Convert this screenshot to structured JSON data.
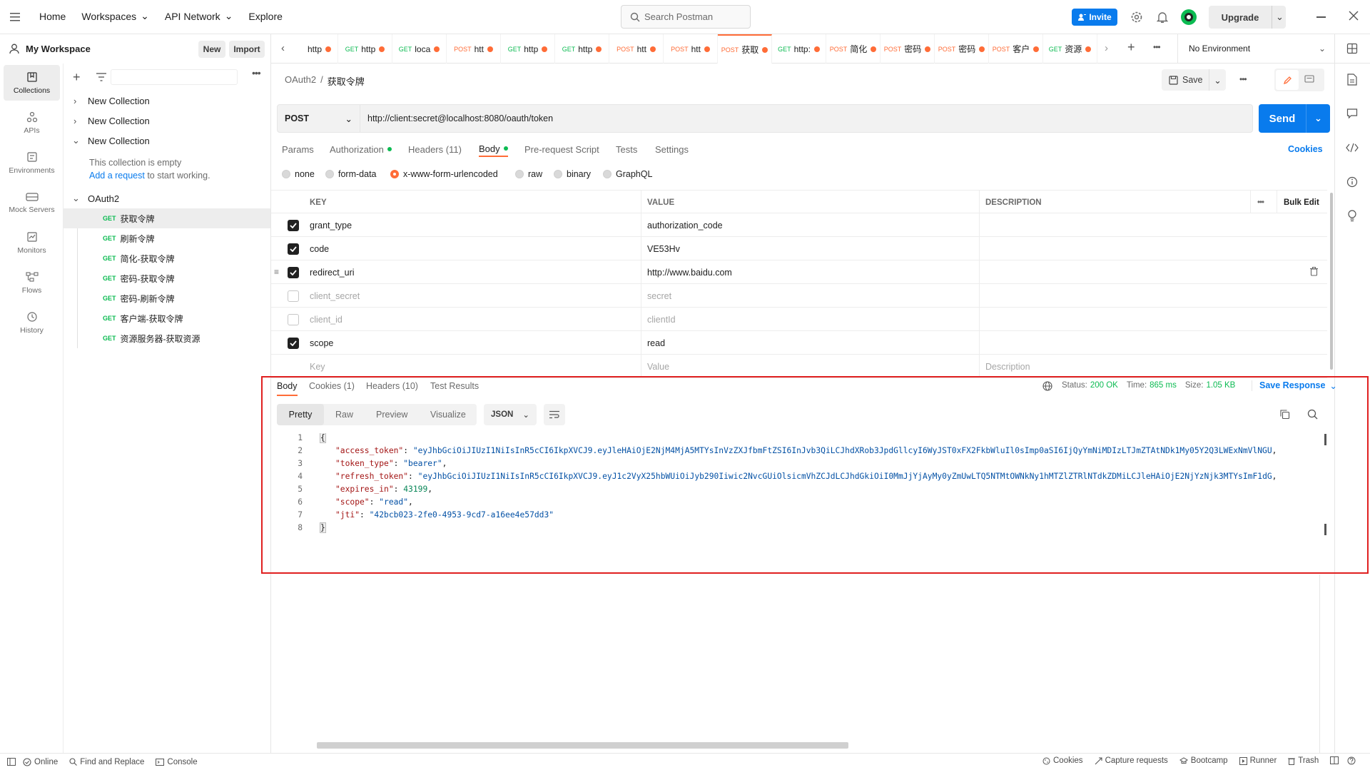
{
  "topbar": {
    "nav": [
      "Home",
      "Workspaces",
      "API Network",
      "Explore"
    ],
    "search_placeholder": "Search Postman",
    "invite_label": "Invite",
    "upgrade_label": "Upgrade"
  },
  "workspace": {
    "name": "My Workspace",
    "new_label": "New",
    "import_label": "Import"
  },
  "rail": [
    "Collections",
    "APIs",
    "Environments",
    "Mock Servers",
    "Monitors",
    "Flows",
    "History"
  ],
  "sidebar": {
    "collections": [
      "New Collection",
      "New Collection",
      "New Collection"
    ],
    "empty_text": "This collection is empty",
    "add_request_link": "Add a request",
    "add_request_rest": " to start working.",
    "oauth_folder": "OAuth2",
    "requests": [
      {
        "method": "GET",
        "name": "获取令牌"
      },
      {
        "method": "GET",
        "name": "刷新令牌"
      },
      {
        "method": "GET",
        "name": "简化-获取令牌"
      },
      {
        "method": "GET",
        "name": "密码-获取令牌"
      },
      {
        "method": "GET",
        "name": "密码-刷新令牌"
      },
      {
        "method": "GET",
        "name": "客户端-获取令牌"
      },
      {
        "method": "GET",
        "name": "资源服务器-获取资源"
      }
    ]
  },
  "tabs": [
    {
      "method": "",
      "label": "http"
    },
    {
      "method": "GET",
      "label": "http"
    },
    {
      "method": "GET",
      "label": "loca"
    },
    {
      "method": "POST",
      "label": "htt"
    },
    {
      "method": "GET",
      "label": "http"
    },
    {
      "method": "GET",
      "label": "http"
    },
    {
      "method": "POST",
      "label": "htt"
    },
    {
      "method": "POST",
      "label": "htt"
    },
    {
      "method": "POST",
      "label": "获取"
    },
    {
      "method": "GET",
      "label": "http:"
    },
    {
      "method": "POST",
      "label": "简化"
    },
    {
      "method": "POST",
      "label": "密码"
    },
    {
      "method": "POST",
      "label": "密码"
    },
    {
      "method": "POST",
      "label": "客户"
    },
    {
      "method": "GET",
      "label": "资源"
    }
  ],
  "environment": "No Environment",
  "request": {
    "breadcrumb_parent": "OAuth2",
    "breadcrumb_sep": "/",
    "breadcrumb_name": "获取令牌",
    "save_label": "Save",
    "method": "POST",
    "url": "http://client:secret@localhost:8080/oauth/token",
    "send_label": "Send",
    "subtabs": [
      "Params",
      "Authorization",
      "Headers (11)",
      "Body",
      "Pre-request Script",
      "Tests",
      "Settings"
    ],
    "cookies_label": "Cookies",
    "body_types": [
      "none",
      "form-data",
      "x-www-form-urlencoded",
      "raw",
      "binary",
      "GraphQL"
    ],
    "columns": [
      "KEY",
      "VALUE",
      "DESCRIPTION"
    ],
    "bulk_edit": "Bulk Edit",
    "params": [
      {
        "checked": true,
        "key": "grant_type",
        "value": "authorization_code"
      },
      {
        "checked": true,
        "key": "code",
        "value": "VE53Hv"
      },
      {
        "checked": true,
        "key": "redirect_uri",
        "value": "http://www.baidu.com"
      },
      {
        "checked": false,
        "key": "client_secret",
        "value": "secret"
      },
      {
        "checked": false,
        "key": "client_id",
        "value": "clientId"
      },
      {
        "checked": true,
        "key": "scope",
        "value": "read"
      }
    ],
    "placeholder_key": "Key",
    "placeholder_value": "Value",
    "placeholder_desc": "Description"
  },
  "response": {
    "tabs": [
      "Body",
      "Cookies (1)",
      "Headers (10)",
      "Test Results"
    ],
    "status_label": "Status:",
    "status_value": "200 OK",
    "time_label": "Time:",
    "time_value": "865 ms",
    "size_label": "Size:",
    "size_value": "1.05 KB",
    "save_response": "Save Response",
    "views": [
      "Pretty",
      "Raw",
      "Preview",
      "Visualize"
    ],
    "format": "JSON",
    "lines": [
      {
        "n": "1",
        "k": "",
        "v": "",
        "t": "open"
      },
      {
        "n": "2",
        "k": "\"access_token\"",
        "v": "\"eyJhbGciOiJIUzI1NiIsInR5cCI6IkpXVCJ9.eyJleHAiOjE2NjM4MjA5MTYsInVzZXJfbmFtZSI6InJvb3QiLCJhdXRob3JpdGllcyI6WyJST0xFX2FkbWluIl0sImp0aSI6IjQyYmNiMDIzLTJmZTAtNDk1My05Y2Q3LWExNmVlNGU",
        "t": "str"
      },
      {
        "n": "3",
        "k": "\"token_type\"",
        "v": "\"bearer\"",
        "t": "str"
      },
      {
        "n": "4",
        "k": "\"refresh_token\"",
        "v": "\"eyJhbGciOiJIUzI1NiIsInR5cCI6IkpXVCJ9.eyJ1c2VyX25hbWUiOiJyb290Iiwic2NvcGUiOlsicmVhZCJdLCJhdGkiOiI0MmJjYjAyMy0yZmUwLTQ5NTMtOWNkNy1hMTZlZTRlNTdkZDMiLCJleHAiOjE2NjYzNjk3MTYsImF1dG",
        "t": "str"
      },
      {
        "n": "5",
        "k": "\"expires_in\"",
        "v": "43199",
        "t": "num"
      },
      {
        "n": "6",
        "k": "\"scope\"",
        "v": "\"read\"",
        "t": "str"
      },
      {
        "n": "7",
        "k": "\"jti\"",
        "v": "\"42bcb023-2fe0-4953-9cd7-a16ee4e57dd3\"",
        "t": "str"
      },
      {
        "n": "8",
        "k": "",
        "v": "",
        "t": "close"
      }
    ]
  },
  "statusbar": {
    "left": [
      "Online",
      "Find and Replace",
      "Console"
    ],
    "right": [
      "Cookies",
      "Capture requests",
      "Bootcamp",
      "Runner",
      "Trash"
    ]
  },
  "colors": {
    "accent": "#ff6c37",
    "primary": "#097bed",
    "green": "#0cbb52",
    "highlight_border": "#e02020"
  }
}
